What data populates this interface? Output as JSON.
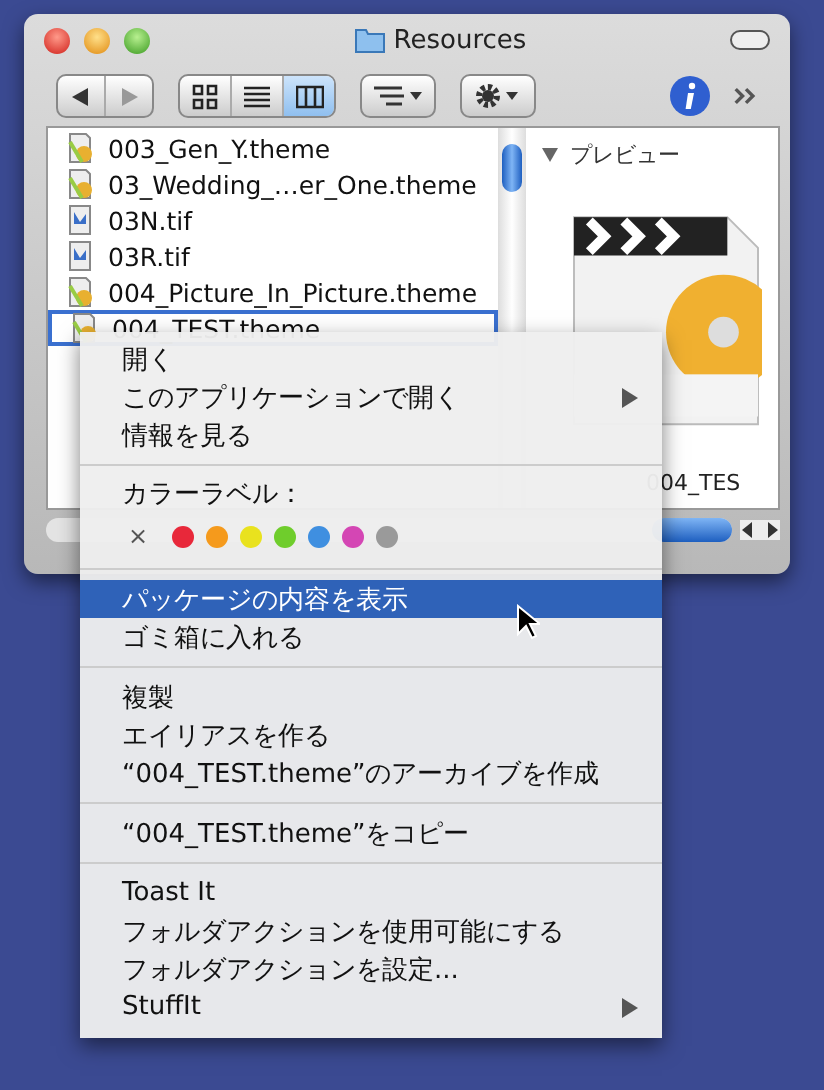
{
  "window": {
    "title": "Resources"
  },
  "toolbar": {
    "views": [
      {
        "kind": "icon",
        "selected": false
      },
      {
        "kind": "list",
        "selected": false
      },
      {
        "kind": "column",
        "selected": true
      }
    ]
  },
  "files": [
    {
      "name": "003_Gen_Y.theme",
      "kind": "theme",
      "selected": false
    },
    {
      "name": "03_Wedding_…er_One.theme",
      "kind": "theme",
      "selected": false
    },
    {
      "name": "03N.tif",
      "kind": "tif",
      "selected": false
    },
    {
      "name": "03R.tif",
      "kind": "tif",
      "selected": false
    },
    {
      "name": "004_Picture_In_Picture.theme",
      "kind": "theme",
      "selected": false
    },
    {
      "name": "004_TEST.theme",
      "kind": "theme",
      "selected": true
    }
  ],
  "preview": {
    "heading": "プレビュー",
    "name": "004_TES"
  },
  "context_menu": [
    {
      "kind": "item",
      "label": "開く",
      "selected": false,
      "submenu": false
    },
    {
      "kind": "item",
      "label": "このアプリケーションで開く",
      "selected": false,
      "submenu": true
    },
    {
      "kind": "item",
      "label": "情報を見る",
      "selected": false,
      "submenu": false
    },
    {
      "kind": "separator"
    },
    {
      "kind": "heading",
      "label": "カラーラベル："
    },
    {
      "kind": "colors",
      "remove": "×",
      "colors": [
        {
          "color": "#e8283a"
        },
        {
          "color": "#f59a1c"
        },
        {
          "color": "#e9e21e"
        },
        {
          "color": "#6fcd2c"
        },
        {
          "color": "#3f8fe0"
        },
        {
          "color": "#d446b4"
        },
        {
          "color": "#9a9a9a"
        }
      ]
    },
    {
      "kind": "separator"
    },
    {
      "kind": "item",
      "label": "パッケージの内容を表示",
      "selected": true,
      "submenu": false
    },
    {
      "kind": "item",
      "label": "ゴミ箱に入れる",
      "selected": false,
      "submenu": false
    },
    {
      "kind": "separator"
    },
    {
      "kind": "item",
      "label": "複製",
      "selected": false,
      "submenu": false
    },
    {
      "kind": "item",
      "label": "エイリアスを作る",
      "selected": false,
      "submenu": false
    },
    {
      "kind": "item",
      "label": "“004_TEST.theme”のアーカイブを作成",
      "selected": false,
      "submenu": false
    },
    {
      "kind": "separator"
    },
    {
      "kind": "item",
      "label": "“004_TEST.theme”をコピー",
      "selected": false,
      "submenu": false
    },
    {
      "kind": "separator"
    },
    {
      "kind": "item",
      "label": "Toast It",
      "selected": false,
      "submenu": false
    },
    {
      "kind": "item",
      "label": "フォルダアクションを使用可能にする",
      "selected": false,
      "submenu": false
    },
    {
      "kind": "item",
      "label": "フォルダアクションを設定...",
      "selected": false,
      "submenu": false
    },
    {
      "kind": "item",
      "label": "StuffIt",
      "selected": false,
      "submenu": true
    }
  ]
}
